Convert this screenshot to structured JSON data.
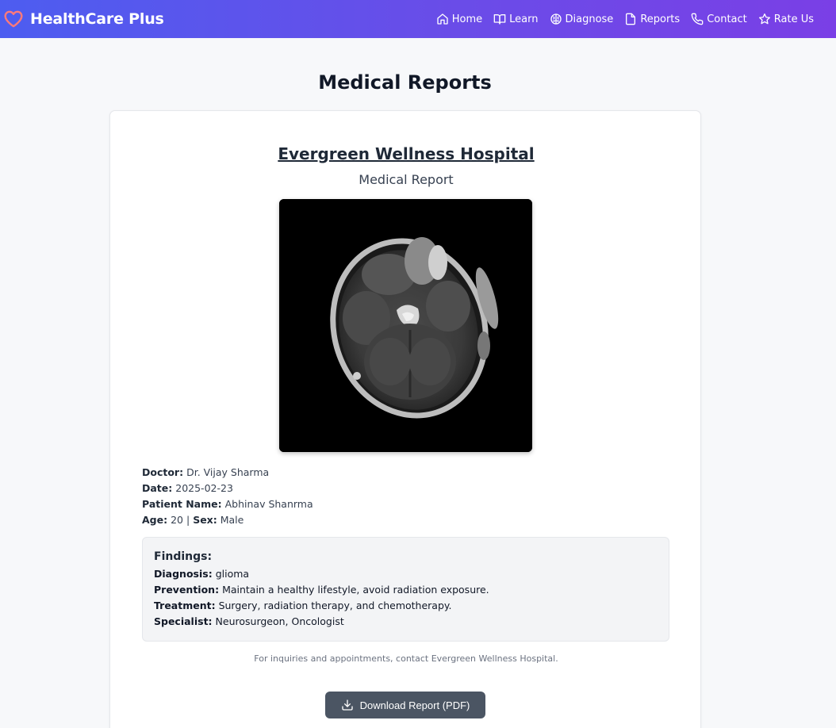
{
  "brand": {
    "title": "HealthCare Plus",
    "icon": "heart-icon"
  },
  "nav": [
    {
      "label": "Home",
      "icon": "home-icon"
    },
    {
      "label": "Learn",
      "icon": "book-icon"
    },
    {
      "label": "Diagnose",
      "icon": "brain-icon"
    },
    {
      "label": "Reports",
      "icon": "file-icon"
    },
    {
      "label": "Contact",
      "icon": "phone-icon"
    },
    {
      "label": "Rate Us",
      "icon": "star-icon"
    }
  ],
  "page": {
    "title": "Medical Reports"
  },
  "report": {
    "hospital": "Evergreen Wellness Hospital",
    "subtitle": "Medical Report",
    "doctor_label": "Doctor:",
    "doctor": "Dr. Vijay Sharma",
    "date_label": "Date:",
    "date": "2025-02-23",
    "patient_label": "Patient Name:",
    "patient": "Abhinav Shanrma",
    "age_label": "Age:",
    "age": "20",
    "separator": "|",
    "sex_label": "Sex:",
    "sex": "Male"
  },
  "findings": {
    "title": "Findings:",
    "diagnosis_label": "Diagnosis:",
    "diagnosis": "glioma",
    "prevention_label": "Prevention:",
    "prevention": "Maintain a healthy lifestyle, avoid radiation exposure.",
    "treatment_label": "Treatment:",
    "treatment": "Surgery, radiation therapy, and chemotherapy.",
    "specialist_label": "Specialist:",
    "specialist": "Neurosurgeon, Oncologist"
  },
  "note": "For inquiries and appointments, contact Evergreen Wellness Hospital.",
  "download": {
    "label": "Download Report (PDF)",
    "icon": "download-icon"
  },
  "colors": {
    "nav_start": "#4d5df0",
    "nav_end": "#7a3fe6",
    "button": "#4b5563",
    "heart": "#ff6b6b"
  }
}
